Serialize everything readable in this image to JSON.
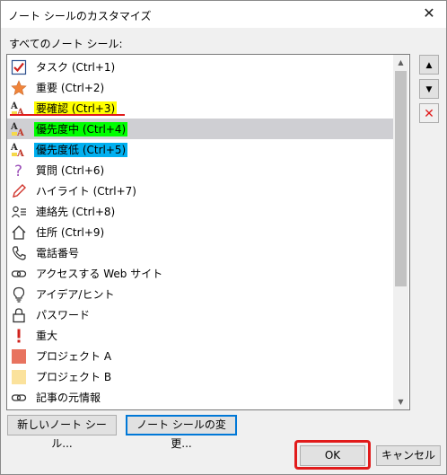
{
  "window": {
    "title": "ノート シールのカスタマイズ",
    "close": "✕"
  },
  "list": {
    "label": "すべてのノート シール:",
    "items": [
      {
        "label": "タスク (Ctrl+1)",
        "icon": "checkbox-icon"
      },
      {
        "label": "重要 (Ctrl+2)",
        "icon": "star-icon"
      },
      {
        "label": "要確認 (Ctrl+3)",
        "icon": "highlight-a-icon",
        "highlight": "#ffff00"
      },
      {
        "label": "優先度中 (Ctrl+4)",
        "icon": "highlight-a-icon",
        "highlight": "#00ff00",
        "selected": true
      },
      {
        "label": "優先度低 (Ctrl+5)",
        "icon": "highlight-a-icon",
        "highlight": "#00b0f0"
      },
      {
        "label": "質問 (Ctrl+6)",
        "icon": "question-icon"
      },
      {
        "label": "ハイライト (Ctrl+7)",
        "icon": "pen-icon"
      },
      {
        "label": "連絡先 (Ctrl+8)",
        "icon": "contact-icon"
      },
      {
        "label": "住所 (Ctrl+9)",
        "icon": "home-icon"
      },
      {
        "label": "電話番号",
        "icon": "phone-icon"
      },
      {
        "label": "アクセスする Web サイト",
        "icon": "link-icon"
      },
      {
        "label": "アイデア/ヒント",
        "icon": "lightbulb-icon"
      },
      {
        "label": "パスワード",
        "icon": "lock-icon"
      },
      {
        "label": "重大",
        "icon": "exclamation-icon"
      },
      {
        "label": "プロジェクト A",
        "icon": "square-icon",
        "color": "#e8735f"
      },
      {
        "label": "プロジェクト B",
        "icon": "square-icon",
        "color": "#fbe29c"
      },
      {
        "label": "記事の元情報",
        "icon": "link-icon"
      }
    ]
  },
  "side": {
    "up": "▲",
    "down": "▼",
    "remove": "✕"
  },
  "buttons": {
    "new_tag": "新しいノート シール...",
    "modify_tag": "ノート シールの変更...",
    "ok": "OK",
    "cancel": "キャンセル"
  },
  "colors": {
    "accent": "#0078d7",
    "annotation_red": "#e11b1b",
    "selection": "#cfcfd3"
  }
}
